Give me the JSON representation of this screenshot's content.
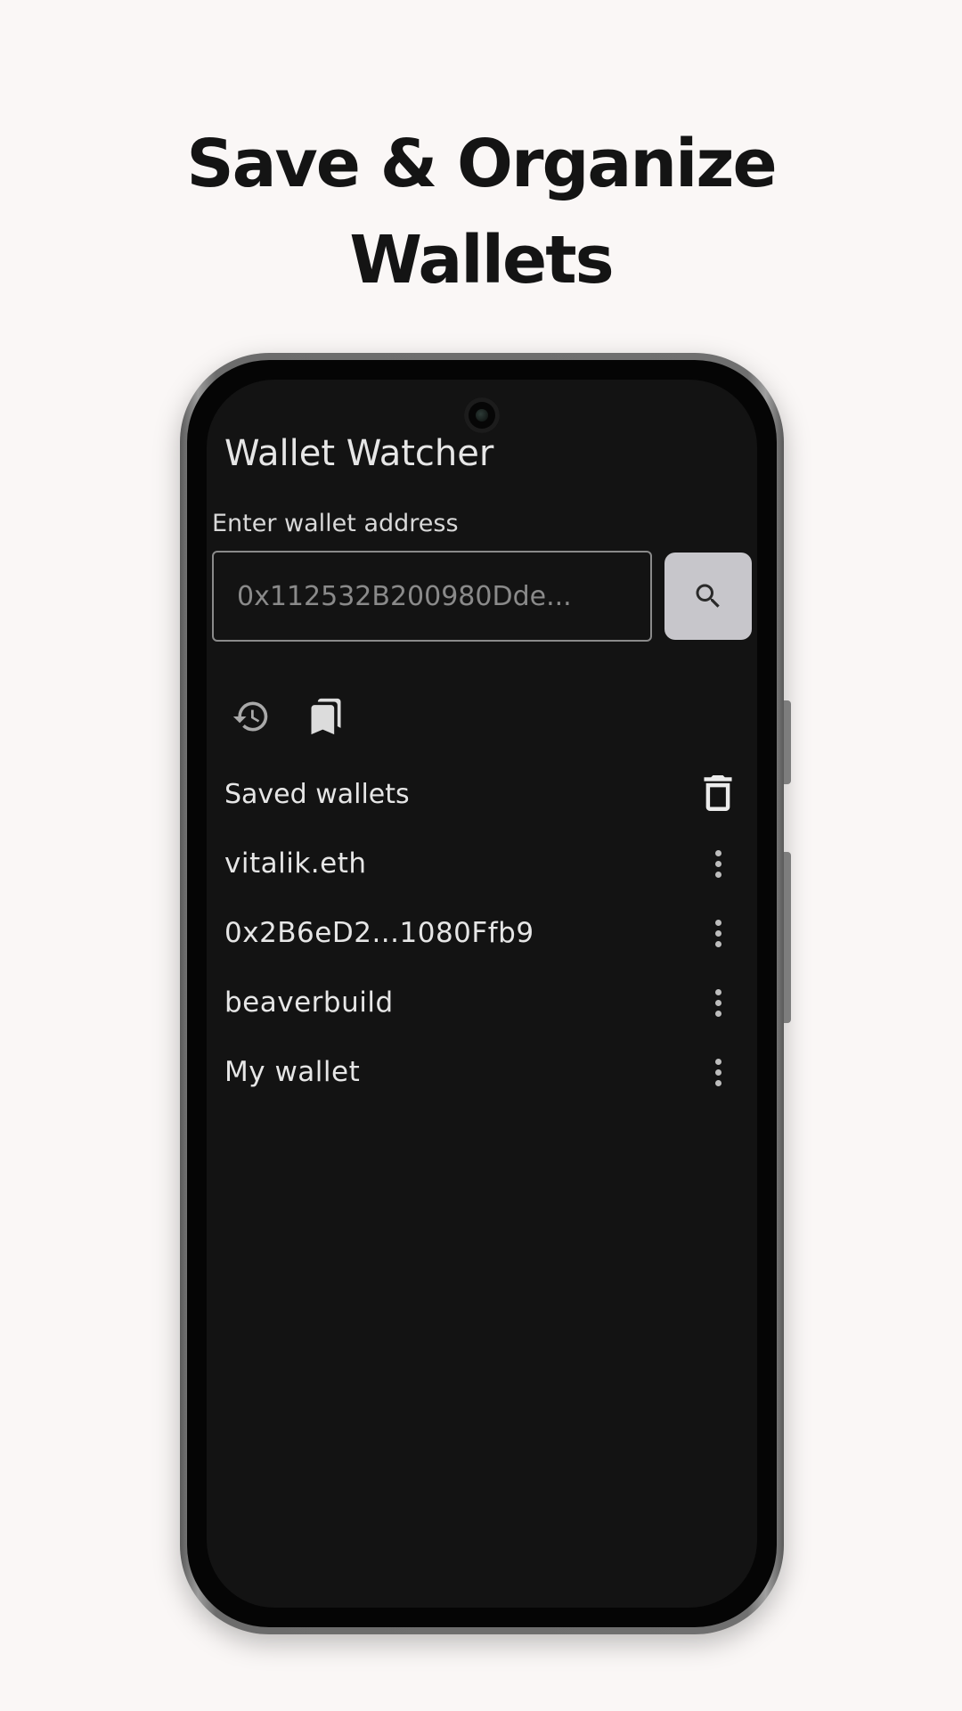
{
  "headline": {
    "line1": "Save & Organize",
    "line2": "Wallets"
  },
  "app": {
    "title": "Wallet Watcher"
  },
  "search": {
    "label": "Enter wallet address",
    "placeholder": "0x112532B200980Dde...",
    "button_icon": "search-icon"
  },
  "tabs": [
    {
      "icon": "history-icon"
    },
    {
      "icon": "bookmarks-icon"
    }
  ],
  "saved": {
    "header": "Saved wallets",
    "clear_icon": "trash-icon",
    "items": [
      {
        "label": "vitalik.eth",
        "menu_icon": "more-vert-icon"
      },
      {
        "label": "0x2B6eD2...1080Ffb9",
        "menu_icon": "more-vert-icon"
      },
      {
        "label": "beaverbuild",
        "menu_icon": "more-vert-icon"
      },
      {
        "label": "My wallet",
        "menu_icon": "more-vert-icon"
      }
    ]
  },
  "colors": {
    "page_background": "#faf7f6",
    "screen_background": "#131313",
    "search_button": "#c7c6cb",
    "text_primary": "#e6e6e6"
  }
}
